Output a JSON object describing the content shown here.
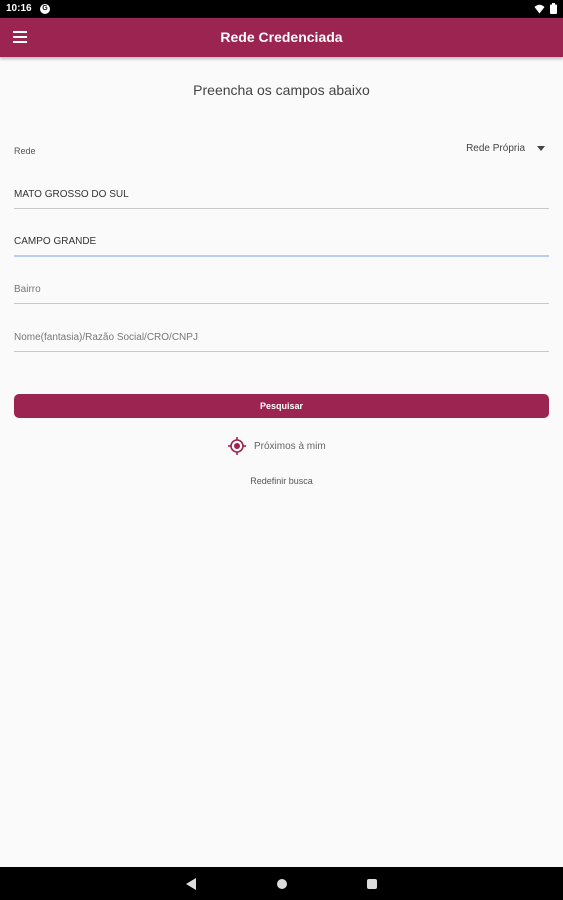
{
  "status_bar": {
    "time": "10:16",
    "notification_glyph": "G"
  },
  "app_bar": {
    "title": "Rede Credenciada",
    "menu_icon": "hamburger-menu-icon"
  },
  "form": {
    "subtitle": "Preencha os campos abaixo",
    "rede": {
      "label": "Rede",
      "selected": "Rede Própria"
    },
    "estado": {
      "value": "MATO GROSSO DO SUL"
    },
    "cidade": {
      "value": "CAMPO GRANDE"
    },
    "bairro": {
      "value": "",
      "placeholder": "Bairro"
    },
    "nome": {
      "value": "",
      "placeholder": "Nome(fantasia)/Razão Social/CRO/CNPJ"
    },
    "search_button": "Pesquisar",
    "near_me": "Próximos à mim",
    "reset": "Redefinir busca"
  },
  "colors": {
    "primary": "#9b2450",
    "focus_underline": "#b9cdf0"
  }
}
